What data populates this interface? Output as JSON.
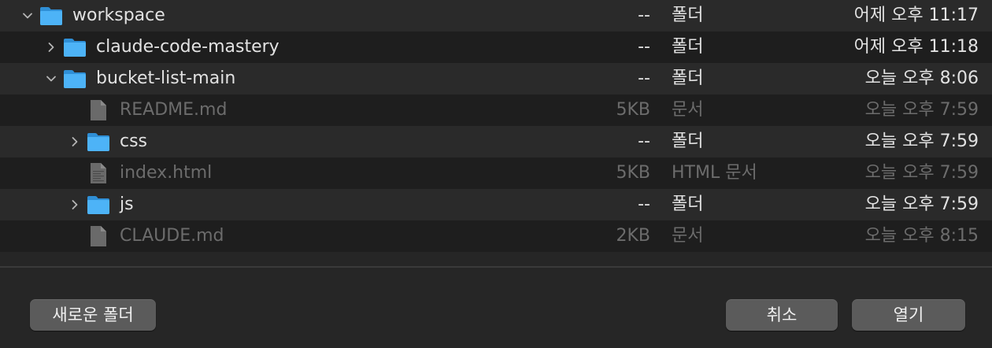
{
  "rows": [
    {
      "name": "workspace",
      "type": "folder",
      "expanded": true,
      "indent": 0,
      "size": "--",
      "kind": "폴더",
      "date": "어제 오후 11:17"
    },
    {
      "name": "claude-code-mastery",
      "type": "folder",
      "expanded": false,
      "indent": 1,
      "size": "--",
      "kind": "폴더",
      "date": "어제 오후 11:18"
    },
    {
      "name": "bucket-list-main",
      "type": "folder",
      "expanded": true,
      "indent": 1,
      "size": "--",
      "kind": "폴더",
      "date": "오늘 오후 8:06"
    },
    {
      "name": "README.md",
      "type": "file",
      "icon": "document-icon",
      "indent": 2,
      "size": "5KB",
      "kind": "문서",
      "date": "오늘 오후 7:59"
    },
    {
      "name": "css",
      "type": "folder",
      "expanded": false,
      "indent": 2,
      "size": "--",
      "kind": "폴더",
      "date": "오늘 오후 7:59"
    },
    {
      "name": "index.html",
      "type": "file",
      "icon": "html-document-icon",
      "indent": 2,
      "size": "5KB",
      "kind": "HTML 문서",
      "date": "오늘 오후 7:59"
    },
    {
      "name": "js",
      "type": "folder",
      "expanded": false,
      "indent": 2,
      "size": "--",
      "kind": "폴더",
      "date": "오늘 오후 7:59"
    },
    {
      "name": "CLAUDE.md",
      "type": "file",
      "icon": "document-icon",
      "indent": 2,
      "size": "2KB",
      "kind": "문서",
      "date": "오늘 오후 8:15"
    }
  ],
  "buttons": {
    "new_folder": "새로운 폴더",
    "cancel": "취소",
    "open": "열기"
  },
  "colors": {
    "folder_icon": "#3fa9f5",
    "background": "#262626",
    "text_enabled": "#e2e2e2",
    "text_disabled": "#6c6c6c"
  }
}
